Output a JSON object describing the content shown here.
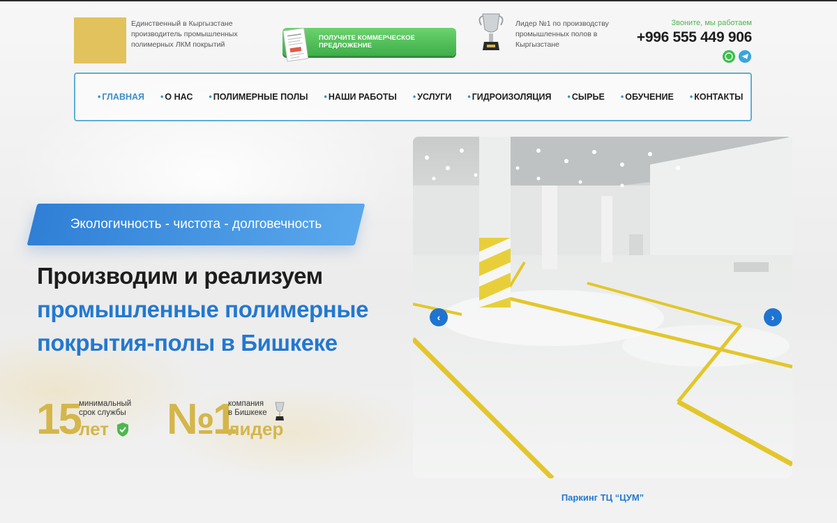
{
  "header": {
    "tagline": "Единственный в Кыргызстане производитель промышленных полимерных ЛКМ покрытий",
    "cta_label": "Получите коммерческое предложение",
    "leader_text": "Лидер №1 по производству промышленных полов в Кыргызстане",
    "call_label": "Звоните, мы работаем",
    "phone": "+996 555 449 906"
  },
  "nav": {
    "items": [
      {
        "label": "Главная",
        "active": true
      },
      {
        "label": "О нас"
      },
      {
        "label": "Полимерные полы"
      },
      {
        "label": "Наши работы"
      },
      {
        "label": "Услуги"
      },
      {
        "label": "Гидроизоляция"
      },
      {
        "label": "Сырье"
      },
      {
        "label": "Обучение"
      },
      {
        "label": "Контакты"
      }
    ]
  },
  "hero": {
    "ribbon": "Экологичность - чистота - долговечность",
    "line1": "Производим и реализуем",
    "line2": "промышленные полимерные",
    "line3": "покрытия-полы в Бишкеке",
    "stat1": {
      "number": "15",
      "label_line1": "минимальный",
      "label_line2": "срок службы",
      "unit": "лет"
    },
    "stat2": {
      "number": "№1",
      "label_line1": "компания",
      "label_line2": "в Бишкеке",
      "unit": "лидер"
    }
  },
  "slider": {
    "caption": "Паркинг ТЦ “ЦУМ”",
    "prev_icon": "chevron-left-icon",
    "next_icon": "chevron-right-icon"
  },
  "colors": {
    "accent_blue": "#2378d0",
    "gold": "#d4b64a",
    "green": "#3fae4a",
    "nav_border": "#5bb0d8"
  }
}
